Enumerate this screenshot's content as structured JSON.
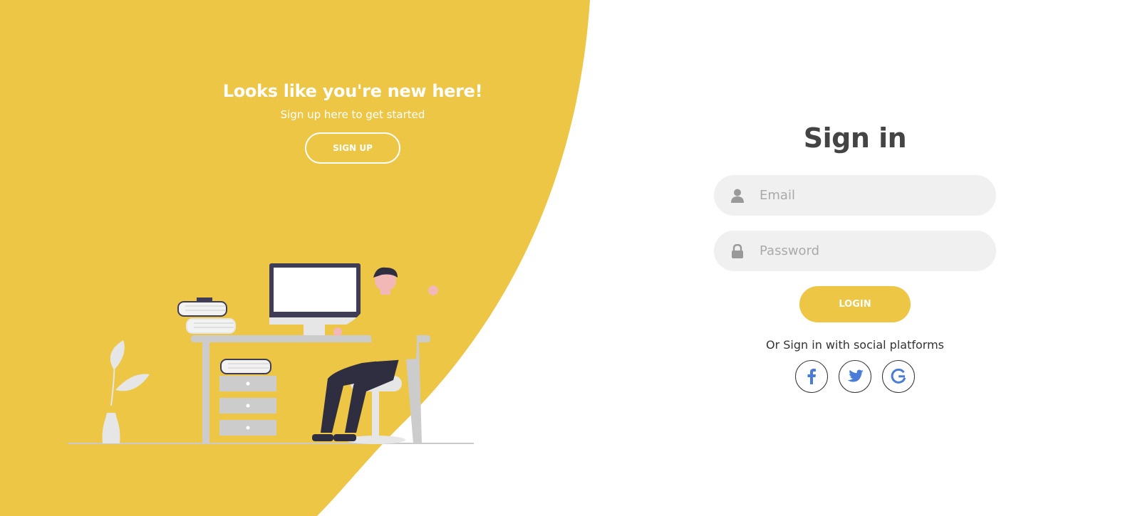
{
  "colors": {
    "accent": "#edc645",
    "white": "#ffffff",
    "input_bg": "#f0f0f0",
    "heading": "#444444",
    "brand_blue": "#4a7bd6"
  },
  "promo": {
    "title": "Looks like you're new here!",
    "subtitle": "Sign up here to get started",
    "signup_label": "SIGN UP"
  },
  "signin": {
    "title": "Sign in",
    "email": {
      "icon": "user-icon",
      "placeholder": "Email",
      "value": ""
    },
    "password": {
      "icon": "lock-icon",
      "placeholder": "Password",
      "value": ""
    },
    "login_label": "LOGIN",
    "social_text": "Or Sign in with social platforms",
    "socials": [
      {
        "name": "facebook",
        "icon": "facebook-icon"
      },
      {
        "name": "twitter",
        "icon": "twitter-icon"
      },
      {
        "name": "google",
        "icon": "google-icon"
      }
    ]
  }
}
